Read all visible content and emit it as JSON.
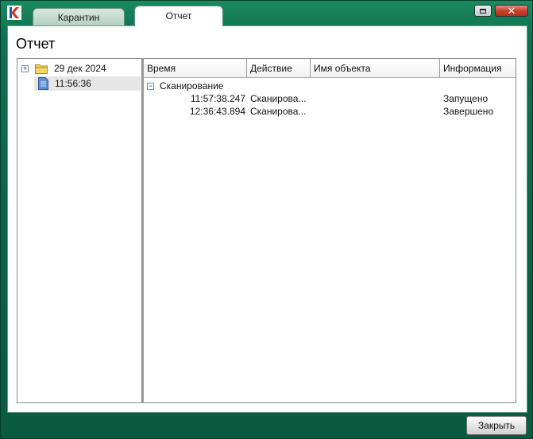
{
  "window": {
    "close_glyph": "✕",
    "logo_icon": "kaspersky-k-icon",
    "accent_color": "#0b6145"
  },
  "tabs": [
    {
      "label": "Карантин",
      "active": false
    },
    {
      "label": "Отчет",
      "active": true
    }
  ],
  "page": {
    "title": "Отчет"
  },
  "tree": {
    "items": [
      {
        "label": "29 дек 2024",
        "icon": "folder-icon",
        "expander": "+"
      },
      {
        "label": "11:56:36",
        "icon": "document-icon",
        "selected": true
      }
    ]
  },
  "report": {
    "columns": [
      "Время",
      "Действие",
      "Имя объекта",
      "Информация"
    ],
    "group": {
      "label": "Сканирование",
      "expander": "−"
    },
    "rows": [
      {
        "time": "11:57:38.247",
        "action": "Сканирова...",
        "object": "",
        "info": "Запущено"
      },
      {
        "time": "12:36:43.894",
        "action": "Сканирова...",
        "object": "",
        "info": "Завершено"
      }
    ]
  },
  "footer": {
    "close_label": "Закрыть"
  }
}
